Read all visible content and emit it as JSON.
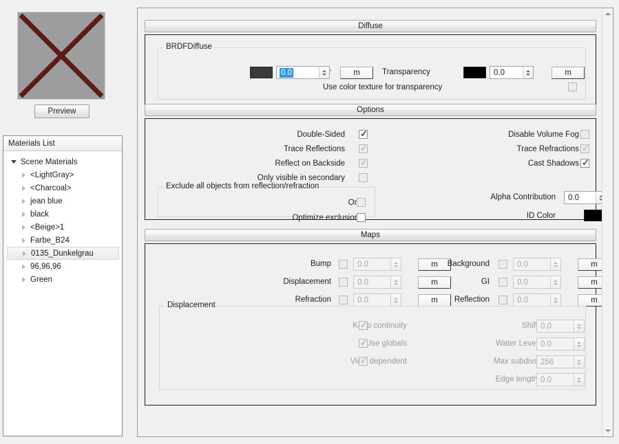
{
  "preview": {
    "button_label": "Preview",
    "thumb_bg": "#9d9d9d",
    "thumb_x_color": "#5c1a18"
  },
  "materials": {
    "header": "Materials List",
    "root": {
      "label": "Scene Materials",
      "expanded": true
    },
    "items": [
      {
        "label": "<LightGray>",
        "selected": false
      },
      {
        "label": "<Charcoal>",
        "selected": false
      },
      {
        "label": "jean blue",
        "selected": false
      },
      {
        "label": "black",
        "selected": false
      },
      {
        "label": "<Beige>1",
        "selected": false
      },
      {
        "label": "Farbe_B24",
        "selected": false
      },
      {
        "label": "0135_Dunkelgrau",
        "selected": true
      },
      {
        "label": "96,96,96",
        "selected": false
      },
      {
        "label": "Green",
        "selected": false
      }
    ]
  },
  "diffuse": {
    "title": "Diffuse",
    "group_title": "BRDFDiffuse",
    "color_label": "Color",
    "color_swatch": "#3a3a3a",
    "color_value": "0.0",
    "color_map_button": "m",
    "transparency_label": "Transparency",
    "transparency_swatch": "#000000",
    "transparency_value": "0.0",
    "transparency_map_button": "m",
    "use_color_texture_label": "Use color texture for transparency"
  },
  "options": {
    "title": "Options",
    "left": [
      {
        "label": "Double-Sided",
        "checked": true,
        "enabled": true
      },
      {
        "label": "Trace Reflections",
        "checked": true,
        "enabled": false
      },
      {
        "label": "Reflect on Backside",
        "checked": true,
        "enabled": false
      },
      {
        "label": "Only visible in secondary",
        "checked": false,
        "enabled": false
      }
    ],
    "right": [
      {
        "label": "Disable Volume Fog",
        "checked": false,
        "enabled": false
      },
      {
        "label": "Trace Refractions",
        "checked": true,
        "enabled": false
      },
      {
        "label": "Cast Shadows",
        "checked": true,
        "enabled": true
      }
    ],
    "exclude_group_title": "Exclude all objects from reflection/refraction",
    "exclude_on_label": "On",
    "optimize_exclusion_label": "Optimize exclusion",
    "alpha_contribution_label": "Alpha Contribution",
    "alpha_contribution_value": "0.0",
    "id_color_label": "ID Color",
    "id_color_swatch": "#000000"
  },
  "maps": {
    "title": "Maps",
    "left": [
      {
        "label": "Bump",
        "value": "0.0",
        "map_button": "m"
      },
      {
        "label": "Displacement",
        "value": "0.0",
        "map_button": "m"
      },
      {
        "label": "Refraction",
        "value": "0.0",
        "map_button": "m"
      }
    ],
    "right": [
      {
        "label": "Background",
        "value": "0.0",
        "map_button": "m"
      },
      {
        "label": "GI",
        "value": "0.0",
        "map_button": "m"
      },
      {
        "label": "Reflection",
        "value": "0.0",
        "map_button": "m"
      }
    ],
    "displacement": {
      "group_title": "Displacement",
      "checks": [
        {
          "label": "Keep continuity",
          "checked": true
        },
        {
          "label": "Use globals",
          "checked": true
        },
        {
          "label": "View dependent",
          "checked": true
        }
      ],
      "fields": [
        {
          "label": "Shift",
          "value": "0.0"
        },
        {
          "label": "Water Level",
          "value": "0.0"
        },
        {
          "label": "Max subdivs",
          "value": "256"
        },
        {
          "label": "Edge length",
          "value": "0.0"
        }
      ]
    }
  }
}
